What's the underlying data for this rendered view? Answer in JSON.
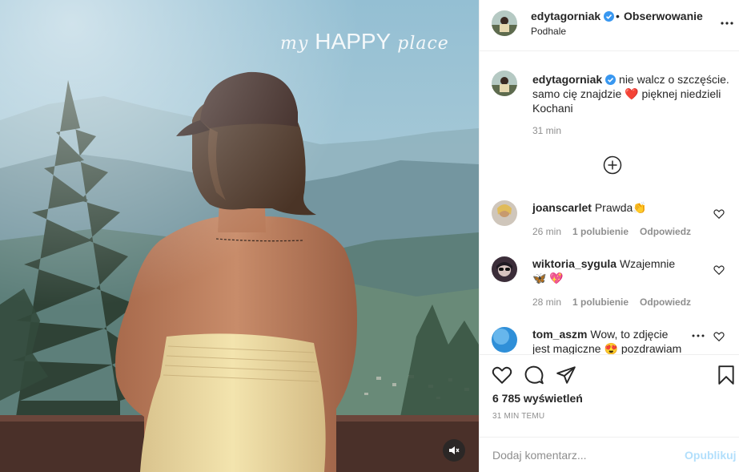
{
  "media": {
    "overlay_prefix": "my",
    "overlay_main": "HAPPY",
    "overlay_suffix": "place",
    "mute_icon": "speaker-muted-icon"
  },
  "post": {
    "author": "edytagorniak",
    "verified": true,
    "follow_separator": "•",
    "follow_label": "Obserwowanie",
    "location": "Podhale",
    "more_icon": "more-options-icon"
  },
  "caption": {
    "username": "edytagorniak",
    "text_before_emoji": "nie walcz o szczęście. samo cię znajdzie",
    "emoji": "❤️",
    "text_after_emoji": "pięknej niedzieli Kochani",
    "time": "31 min",
    "load_more_icon": "plus-circle-icon"
  },
  "comments": [
    {
      "username": "joanscarlet",
      "text": "Prawda",
      "emoji": "👏",
      "time": "26 min",
      "likes": "1 polubienie",
      "reply": "Odpowiedz"
    },
    {
      "username": "wiktoria_sygula",
      "text": "Wzajemnie",
      "emoji": "🦋",
      "emoji2": "💖",
      "time": "28 min",
      "likes": "1 polubienie",
      "reply": "Odpowiedz"
    },
    {
      "username": "tom_aszm",
      "text": "Wow, to zdjęcie jest magiczne",
      "emoji": "😍",
      "text_after": "pozdrawiam Edi"
    }
  ],
  "actions": {
    "like_icon": "heart-icon",
    "comment_icon": "comment-icon",
    "share_icon": "paper-plane-icon",
    "save_icon": "bookmark-icon",
    "views": "6 785 wyświetleń",
    "time_ago": "31 MIN TEMU"
  },
  "composer": {
    "placeholder": "Dodaj komentarz...",
    "submit_label": "Opublikuj",
    "submit_color": "#b2dffc"
  },
  "colors": {
    "text": "#262626",
    "secondary": "#8e8e8e",
    "verified": "#3897f0",
    "border": "#efefef"
  }
}
